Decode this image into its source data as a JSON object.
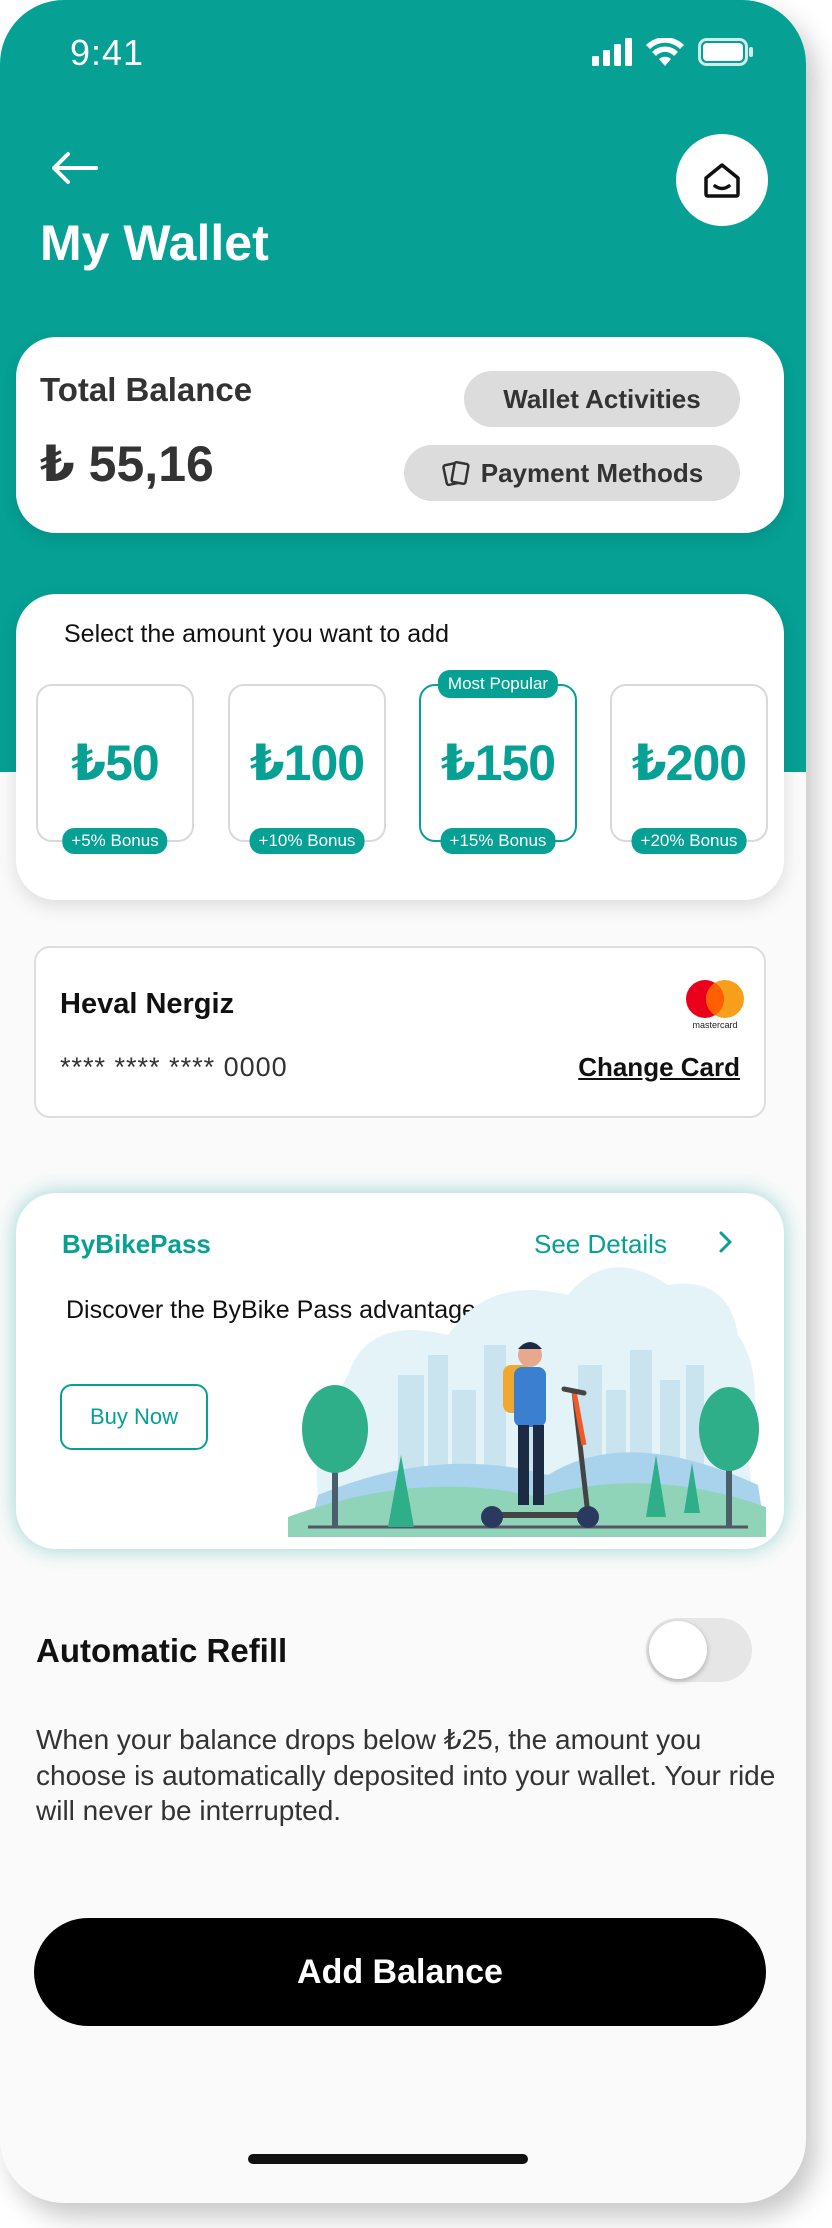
{
  "status_bar": {
    "time": "9:41"
  },
  "header": {
    "title": "My Wallet"
  },
  "balance": {
    "label": "Total Balance",
    "value": "₺ 55,16",
    "wallet_activities_label": "Wallet Activities",
    "payment_methods_label": "Payment Methods"
  },
  "amounts": {
    "title": "Select the amount you want to add",
    "popular_label": "Most Popular",
    "options": [
      {
        "value": "₺50",
        "bonus": "+5% Bonus"
      },
      {
        "value": "₺100",
        "bonus": "+10% Bonus"
      },
      {
        "value": "₺150",
        "bonus": "+15% Bonus"
      },
      {
        "value": "₺200",
        "bonus": "+20% Bonus"
      }
    ]
  },
  "card": {
    "holder": "Heval Nergiz",
    "number": "**** **** **** 0000",
    "change_label": "Change Card",
    "brand_text": "mastercard"
  },
  "pass": {
    "title": "ByBikePass",
    "see_details": "See Details",
    "description": "Discover the ByBike Pass advantages now!",
    "buy_now": "Buy Now"
  },
  "refill": {
    "title": "Automatic Refill",
    "enabled": false,
    "description": "When your balance drops below ₺25, the amount you choose is automatically deposited into your wallet. Your ride will never be interrupted."
  },
  "action": {
    "add_balance": "Add Balance"
  },
  "colors": {
    "accent": "#06a095",
    "background": "#fafafa",
    "primary_button": "#000000"
  },
  "icons": [
    "back-arrow-icon",
    "home-icon",
    "signal-icon",
    "wifi-icon",
    "battery-icon",
    "cards-icon",
    "mastercard-logo",
    "chevron-right-icon"
  ]
}
